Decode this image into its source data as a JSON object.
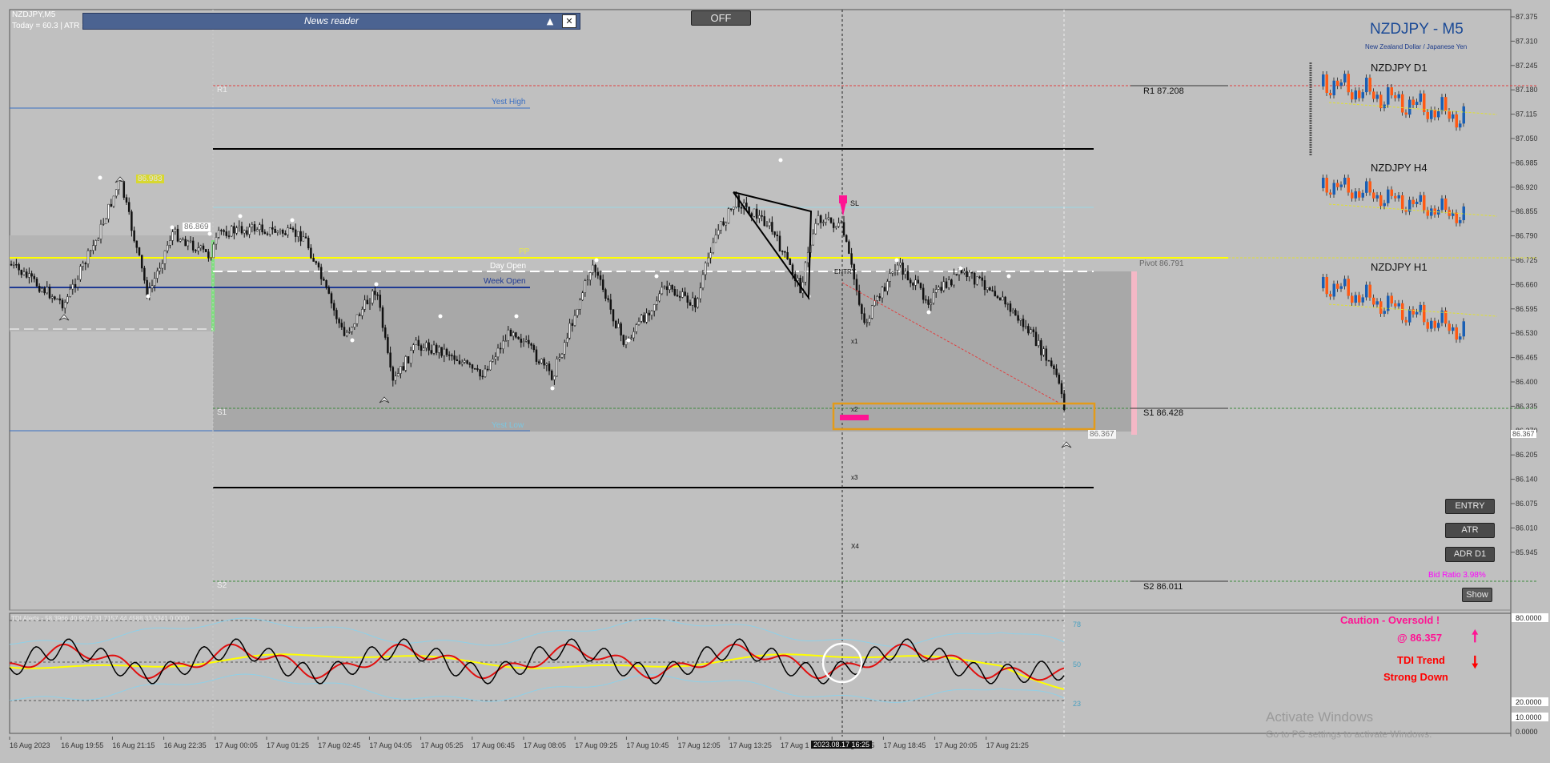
{
  "symbol_header": {
    "symbol": "NZDJPY,M5",
    "stats": "Today = 60.3   |   ATR = 71   |   ATR Projection Up = 87.05   |   ATR Projection Down = 86.34"
  },
  "news_reader": {
    "title": "News reader",
    "minimize": "▲",
    "close": "✕"
  },
  "off_button": "OFF",
  "title_panel": {
    "title": "NZDJPY - M5",
    "subtitle": "New Zealand Dollar / Japanese Yen"
  },
  "mini_charts": {
    "d1": "NZDJPY D1",
    "h4": "NZDJPY H4",
    "h1": "NZDJPY H1"
  },
  "price_axis": [
    "87.375",
    "87.310",
    "87.245",
    "87.180",
    "87.115",
    "87.050",
    "86.985",
    "86.920",
    "86.855",
    "86.790",
    "86.725",
    "86.660",
    "86.595",
    "86.530",
    "86.465",
    "86.400",
    "86.335",
    "86.270",
    "86.205",
    "86.140",
    "86.075",
    "86.010",
    "85.945"
  ],
  "current_price_tag": "86.367",
  "levels": {
    "r1_left": "R1",
    "s1_left": "S1",
    "s2_left": "S2",
    "yest_high": "Yest High",
    "yest_low": "Yest Low",
    "pp": "PP",
    "day_open": "Day Open",
    "week_open": "Week Open",
    "r1_right": "R1 87.208",
    "pivot_right": "Pivot 86.791",
    "s1_right": "S1 86.428",
    "s2_right": "S2 86.011"
  },
  "markers": {
    "high_price": "86.983",
    "local_price": "86.869",
    "chart_price": "86.367",
    "sl": "SL",
    "entry": "ENTRY",
    "x1": "x1",
    "x2": "x2",
    "x3": "x3",
    "x4": "X4"
  },
  "side_buttons": {
    "entry": "ENTRY",
    "atr": "ATR",
    "adr": "ADR D1",
    "show": "Show"
  },
  "bid_ratio": "Bid Ratio 3.98%",
  "indicator": {
    "header": "TDI Alerts - 58.3966 40.9571 31.7157 44.4588 33.5341 0.0000",
    "levels": [
      "78",
      "50",
      "23"
    ],
    "axis": [
      "80.0000",
      "20.0000",
      "10.0000",
      "0.0000"
    ],
    "caution": "Caution - Oversold !",
    "caution_price": "@ 86.357",
    "trend_title": "TDI Trend",
    "trend_value": "Strong Down"
  },
  "time_axis": [
    "16 Aug 2023",
    "16 Aug 19:55",
    "16 Aug 21:15",
    "16 Aug 22:35",
    "17 Aug 00:05",
    "17 Aug 01:25",
    "17 Aug 02:45",
    "17 Aug 04:05",
    "17 Aug 05:25",
    "17 Aug 06:45",
    "17 Aug 08:05",
    "17 Aug 09:25",
    "17 Aug 10:45",
    "17 Aug 12:05",
    "17 Aug 13:25",
    "17 Aug 1",
    "17 Aug 17:25",
    "17 Aug 18:45",
    "17 Aug 20:05",
    "17 Aug 21:25"
  ],
  "crosshair_time": "2023.08.17 16:25",
  "watermark": {
    "line1": "Activate Windows",
    "line2": "Go to PC settings to activate Windows."
  },
  "colors": {
    "bull": "#1a5fb4",
    "bear": "#ff5a14",
    "pp_yellow": "#ffff00",
    "week_open": "#1f3a93",
    "caution": "#ff1493",
    "trend": "#ff0000",
    "zone": "#e39b1a"
  }
}
